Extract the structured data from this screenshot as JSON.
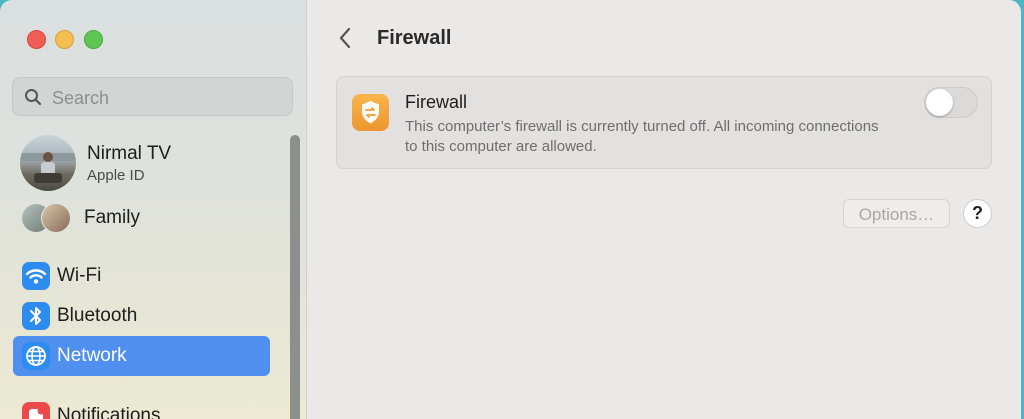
{
  "window_controls": {
    "close": "close",
    "minimize": "minimize",
    "zoom": "zoom"
  },
  "sidebar": {
    "search": {
      "placeholder": "Search",
      "value": ""
    },
    "account": {
      "name": "Nirmal TV",
      "subtitle": "Apple ID"
    },
    "family": {
      "label": "Family"
    },
    "items": [
      {
        "label": "Wi-Fi",
        "icon": "wifi-icon",
        "color": "#2d8cf0",
        "selected": false
      },
      {
        "label": "Bluetooth",
        "icon": "bluetooth-icon",
        "color": "#2d8cf0",
        "selected": false
      },
      {
        "label": "Network",
        "icon": "globe-icon",
        "color": "#2d8cf0",
        "selected": true
      },
      {
        "label": "Notifications",
        "icon": "bell-icon",
        "color": "#ec4a4a",
        "selected": false
      }
    ]
  },
  "main": {
    "title": "Firewall",
    "firewall": {
      "title": "Firewall",
      "description": "This computer’s firewall is currently turned off. All incoming connections to this computer are allowed.",
      "enabled": false,
      "icon": "firewall-shield-icon"
    },
    "options_label": "Options…",
    "help_label": "?"
  },
  "colors": {
    "accent": "#4f8ff0",
    "firewall_icon": "#f5a83c",
    "close": "#ee5e56",
    "minimize": "#f4bd4f",
    "zoom": "#5fc554"
  }
}
